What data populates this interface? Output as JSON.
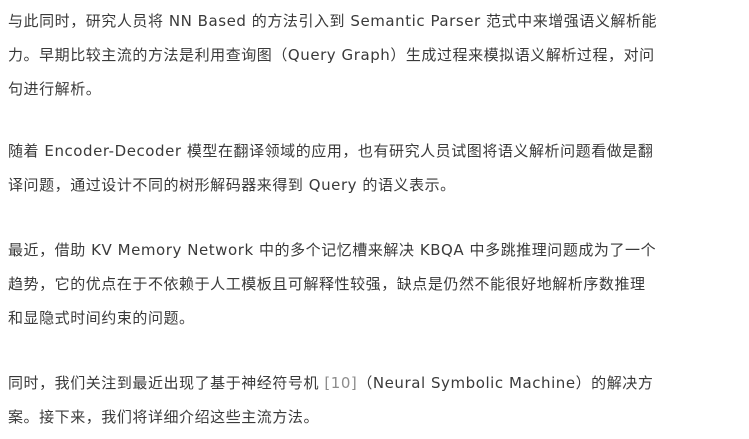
{
  "paragraphs": [
    {
      "lines": [
        "与此同时，研究人员将 NN Based 的方法引入到 Semantic Parser 范式中来增强语义解析能",
        "力。早期比较主流的方法是利用查询图（Query Graph）生成过程来模拟语义解析过程，对问",
        "句进行解析。"
      ]
    },
    {
      "lines": [
        "随着 Encoder-Decoder 模型在翻译领域的应用，也有研究人员试图将语义解析问题看做是翻",
        "译问题，通过设计不同的树形解码器来得到 Query 的语义表示。"
      ]
    },
    {
      "lines": [
        "最近，借助 KV Memory Network 中的多个记忆槽来解决 KBQA 中多跳推理问题成为了一个",
        "趋势，它的优点在于不依赖于人工模板且可解释性较强，缺点是仍然不能很好地解析序数推理",
        "和显隐式时间约束的问题。"
      ]
    },
    {
      "line1_before_ref": "同时，我们关注到最近出现了基于神经符号机 ",
      "ref": "[10]",
      "line1_after_ref": "（Neural Symbolic Machine）的解决方",
      "line2": "案。接下来，我们将详细介绍这些主流方法。"
    }
  ],
  "colors": {
    "text": "#3a3a3a",
    "reference": "#8c8c8c",
    "background": "#ffffff"
  }
}
